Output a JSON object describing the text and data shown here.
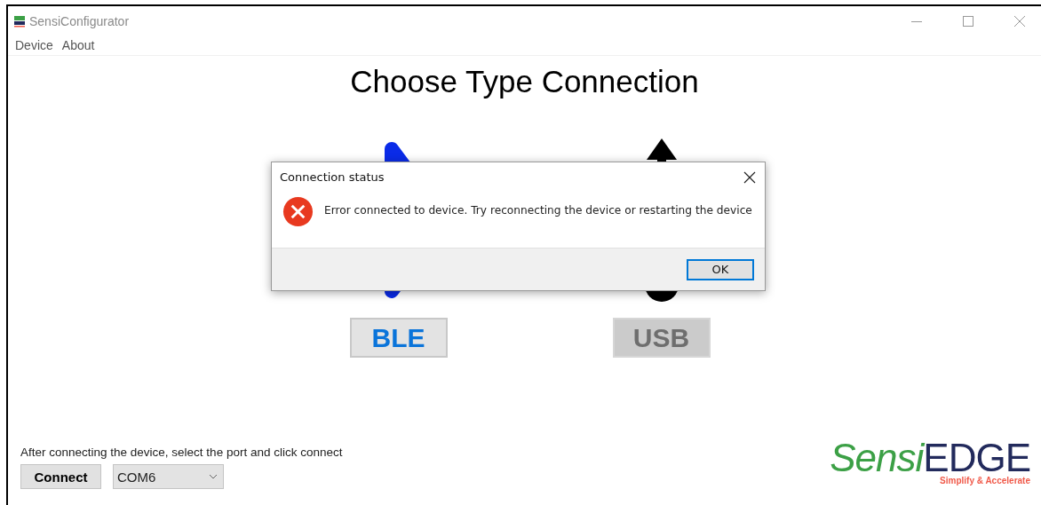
{
  "window": {
    "title": "SensiConfigurator"
  },
  "menu": [
    {
      "label": "Device"
    },
    {
      "label": "About"
    }
  ],
  "heading": "Choose Type Connection",
  "options": [
    {
      "label": "BLE",
      "kind": "bluetooth",
      "disabled": false
    },
    {
      "label": "USB",
      "kind": "usb",
      "disabled": true
    }
  ],
  "dialog": {
    "title": "Connection status",
    "kind": "error",
    "message": "Error connected to device. Try reconnecting the device or restarting the device",
    "button": "OK"
  },
  "footer": {
    "instruction": "After connecting the device, select the port and click connect",
    "connect_button": "Connect",
    "port": "COM6"
  },
  "logo": {
    "first": "Sensi",
    "second": "EDGE",
    "tagline": "Simplify & Accelerate"
  }
}
